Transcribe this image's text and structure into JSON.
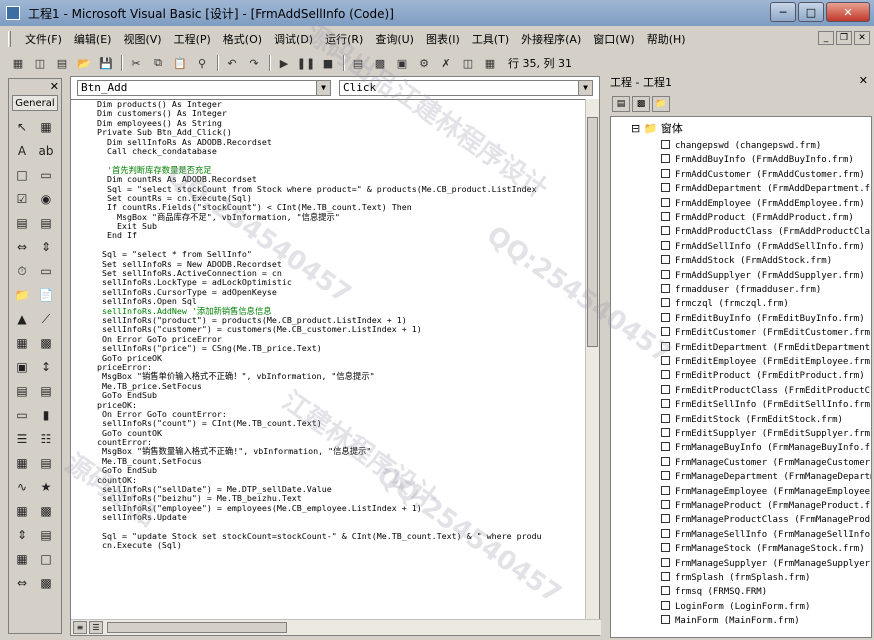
{
  "window": {
    "title": "工程1 - Microsoft Visual Basic [设计] - [FrmAddSellInfo (Code)]"
  },
  "menu": [
    "文件(F)",
    "编辑(E)",
    "视图(V)",
    "工程(P)",
    "格式(O)",
    "调试(D)",
    "运行(R)",
    "查询(U)",
    "图表(I)",
    "工具(T)",
    "外接程序(A)",
    "窗口(W)",
    "帮助(H)"
  ],
  "toolbar": {
    "position": "行 35, 列 31"
  },
  "toolbox": {
    "tab": "General"
  },
  "code": {
    "object": "Btn_Add",
    "procedure": "Click",
    "lines": [
      "Dim products() As Integer",
      "Dim customers() As Integer",
      "Dim employees() As String",
      "Private Sub Btn_Add_Click()",
      "  Dim sellInfoRs As ADODB.Recordset",
      "  Call check_condatabase",
      "",
      "  '首先判断库存数量是否充足",
      "  Dim countRs As ADODB.Recordset",
      "  Sql = \"select stockCount from Stock where product=\" & products(Me.CB_product.ListIndex",
      "  Set countRs = cn.Execute(Sql)",
      "  If countRs.Fields(\"stockCount\") < CInt(Me.TB_count.Text) Then",
      "    MsgBox \"商品库存不足\", vbInformation, \"信息提示\"",
      "    Exit Sub",
      "  End If",
      "",
      " Sql = \"select * from SellInfo\"",
      " Set sellInfoRs = New ADODB.Recordset",
      " Set sellInfoRs.ActiveConnection = cn",
      " sellInfoRs.LockType = adLockOptimistic",
      " sellInfoRs.CursorType = adOpenKeyse",
      " sellInfoRs.Open Sql",
      " sellInfoRs.AddNew '添加新销售信息信息",
      " sellInfoRs(\"product\") = products(Me.CB_product.ListIndex + 1)",
      " sellInfoRs(\"customer\") = customers(Me.CB_customer.ListIndex + 1)",
      " On Error GoTo priceError",
      " sellInfoRs(\"price\") = CSng(Me.TB_price.Text)",
      " GoTo priceOK",
      "priceError:",
      " MsgBox \"销售单价输入格式不正确！\", vbInformation, \"信息提示\"",
      " Me.TB_price.SetFocus",
      " GoTo EndSub",
      "priceOK:",
      " On Error GoTo countError:",
      " sellInfoRs(\"count\") = CInt(Me.TB_count.Text)",
      " GoTo countOK",
      "countError:",
      " MsgBox \"销售数量输入格式不正确!\", vbInformation, \"信息提示\"",
      " Me.TB_count.SetFocus",
      " GoTo EndSub",
      "countOK:",
      " sellInfoRs(\"sellDate\") = Me.DTP_sellDate.Value",
      " sellInfoRs(\"beizhu\") = Me.TB_beizhu.Text",
      " sellInfoRs(\"employee\") = employees(Me.CB_employee.ListIndex + 1)",
      " sellInfoRs.Update",
      "",
      " Sql = \"update Stock set stockCount=stockCount-\" & CInt(Me.TB_count.Text) & \" where produ",
      " cn.Execute (Sql)"
    ],
    "comment_indices": [
      7,
      22
    ]
  },
  "project": {
    "title": "工程 - 工程1",
    "folder": "窗体",
    "items": [
      "changepswd (changepswd.frm)",
      "FrmAddBuyInfo (FrmAddBuyInfo.frm)",
      "FrmAddCustomer (FrmAddCustomer.frm)",
      "FrmAddDepartment (FrmAddDepartment.frm)",
      "FrmAddEmployee (FrmAddEmployee.frm)",
      "FrmAddProduct (FrmAddProduct.frm)",
      "FrmAddProductClass (FrmAddProductClass.frm)",
      "FrmAddSellInfo (FrmAddSellInfo.frm)",
      "FrmAddStock (FrmAddStock.frm)",
      "FrmAddSupplyer (FrmAddSupplyer.frm)",
      "frmadduser (frmadduser.frm)",
      "frmczql (frmczql.frm)",
      "FrmEditBuyInfo (FrmEditBuyInfo.frm)",
      "FrmEditCustomer (FrmEditCustomer.frm)",
      "FrmEditDepartment (FrmEditDepartment.frm)",
      "FrmEditEmployee (FrmEditEmployee.frm)",
      "FrmEditProduct (FrmEditProduct.frm)",
      "FrmEditProductClass (FrmEditProductClass.frm)",
      "FrmEditSellInfo (FrmEditSellInfo.frm)",
      "FrmEditStock (FrmEditStock.frm)",
      "FrmEditSupplyer (FrmEditSupplyer.frm)",
      "FrmManageBuyInfo (FrmManageBuyInfo.frm)",
      "FrmManageCustomer (FrmManageCustomer.frm)",
      "FrmManageDepartment (FrmManageDepartment.frm)",
      "FrmManageEmployee (FrmManageEmployee.frm)",
      "FrmManageProduct (FrmManageProduct.frm)",
      "FrmManageProductClass (FrmManageProductClass.frm)",
      "FrmManageSellInfo (FrmManageSellInfo.frm)",
      "FrmManageStock (FrmManageStock.frm)",
      "FrmManageSupplyer (FrmManageSupplyer.frm)",
      "frmSplash (frmSplash.frm)",
      "frmsq (FRMSQ.FRM)",
      "LoginForm (LoginForm.frm)",
      "MainForm (MainForm.frm)"
    ]
  },
  "watermark": [
    "源码出品",
    "QQ:254540457",
    "江建林程序设计",
    "QQ:254540457",
    "江建林程序设计",
    "QQ:254540457",
    "源码出品"
  ]
}
